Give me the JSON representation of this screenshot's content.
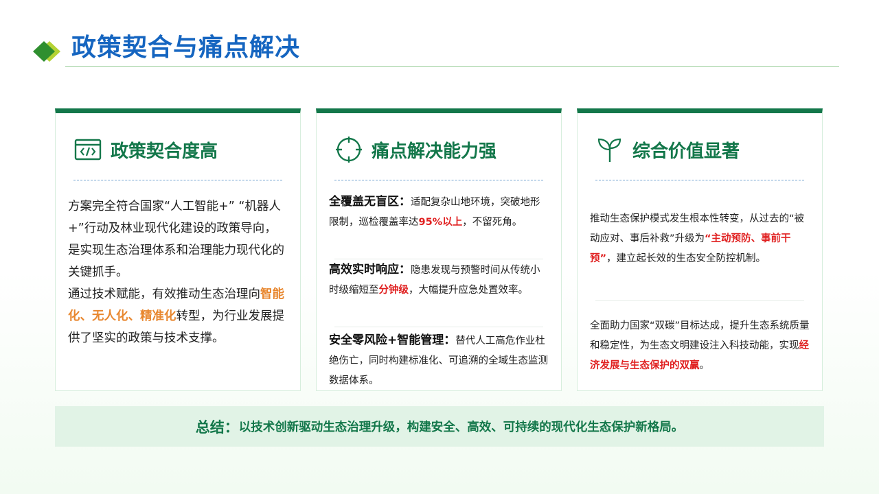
{
  "page": {
    "title": "政策契合与痛点解决",
    "accent_color": "#13774a",
    "title_color": "#1565c0"
  },
  "cards": [
    {
      "icon": "code-window-icon",
      "title": "政策契合度高",
      "p1": "方案完全符合国家“人工智能+” “机器人+”行动及林业现代化建设的政策导向，是实现生态治理体系和治理能力现代化的关键抓手。",
      "p2_before": "通过技术赋能，有效推动生态治理向",
      "p2_highlight": "智能化、无人化、精准化",
      "p2_after": "转型，为行业发展提供了坚实的政策与技术支撑。"
    },
    {
      "icon": "crosshair-icon",
      "title": "痛点解决能力强",
      "items": [
        {
          "key": "全覆盖无盲区：",
          "before": "适配复杂山地环境，突破地形限制，巡检覆盖率达",
          "highlight": "95%以上",
          "after": "，不留死角。"
        },
        {
          "key": "高效实时响应：",
          "before": "隐患发现与预警时间从传统小时级缩短至",
          "highlight": "分钟级",
          "after": "，大幅提升应急处置效率。"
        },
        {
          "key": "安全零风险+智能管理：",
          "before": "替代人工高危作业杜绝伤亡，同时构建标准化、可追溯的全域生态监测数据体系。",
          "highlight": "",
          "after": ""
        }
      ]
    },
    {
      "icon": "sprout-icon",
      "title": "综合价值显著",
      "p1_before": "推动生态保护模式发生根本性转变，从过去的“被动应对、事后补救”升级为",
      "p1_highlight": "“主动预防、事前干预”",
      "p1_after": "，建立起长效的生态安全防控机制。",
      "p2_before": "全面助力国家“双碳”目标达成，提升生态系统质量和稳定性，为生态文明建设注入科技动能，实现",
      "p2_highlight": "经济发展与生态保护的双赢",
      "p2_after": "。"
    }
  ],
  "summary": {
    "label": "总结：",
    "text": "以技术创新驱动生态治理升级，构建安全、高效、可持续的现代化生态保护新格局。"
  }
}
